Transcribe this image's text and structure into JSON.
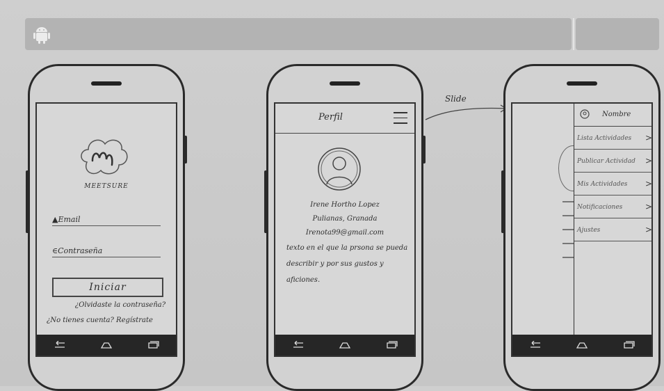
{
  "login": {
    "logo_text": "MEETSURE",
    "email_placeholder": "Email",
    "password_placeholder": "Contraseña",
    "login_button": "Iniciar",
    "forgot_password": "¿Olvidaste la contraseña?",
    "register": "¿No tienes cuenta? Regístrate"
  },
  "profile": {
    "title": "Perfil",
    "name": "Irene Hortho Lopez",
    "location": "Pulianas, Granada",
    "email": "Irenota99@gmail.com",
    "bio": "texto en el que la prsona se pueda describir y por sus gustos y aficiones."
  },
  "annotation": {
    "slide": "Slide"
  },
  "drawer": {
    "header_name": "Nombre",
    "items": [
      {
        "label": "Lista Actividades",
        "chevron": ">"
      },
      {
        "label": "Publicar Actividad",
        "chevron": ">"
      },
      {
        "label": "Mis Actividades",
        "chevron": ">"
      },
      {
        "label": "Notificaciones",
        "chevron": ">"
      },
      {
        "label": "Ajustes",
        "chevron": ">"
      }
    ]
  },
  "icons": {
    "topbar": "android-icon",
    "nav": [
      "back-icon",
      "home-icon",
      "recent-apps-icon"
    ],
    "profile_menu": "hamburger-menu-icon"
  }
}
